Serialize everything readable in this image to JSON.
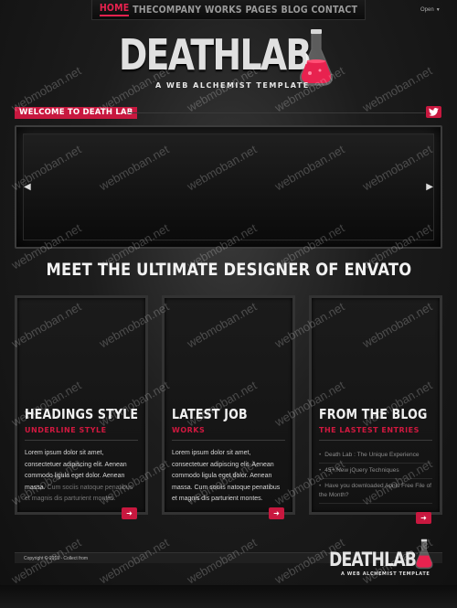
{
  "nav": {
    "items": [
      "HOME",
      "THECOMPANY",
      "WORKS",
      "PAGES",
      "BLOG",
      "CONTACT"
    ],
    "active_index": 0,
    "open_label": "Open"
  },
  "logo": {
    "name": "DEATHLAB",
    "tagline": "A WEB ALCHEMIST TEMPLATE",
    "flask_color": "#e8224f"
  },
  "welcome": {
    "label": "WELCOME TO DEATH LAB",
    "twitter_icon": "twitter-bird-icon"
  },
  "slider": {
    "prev_icon": "chevron-left-icon",
    "next_icon": "chevron-right-icon"
  },
  "headline": "MEET THE ULTIMATE DESIGNER OF ENVATO",
  "columns": [
    {
      "title": "HEADINGS STYLE",
      "subtitle": "UNDERLINE STYLE",
      "body_main": "Lorem ipsum dolor sit amet, consectetuer adipiscing elit. Aenean commodo ligula eget dolor. Aenean massa. ",
      "body_dim": "Cum sociis natoque penatibus et magnis dis parturient montes."
    },
    {
      "title": "LATEST JOB",
      "subtitle": "WORKS",
      "body_main": "Lorem ipsum dolor sit amet, consectetuer adipiscing elit. Aenean commodo ligula eget dolor. Aenean massa. Cum sociis natoque penatibus et magnis dis parturient montes.",
      "body_dim": ""
    },
    {
      "title": "FROM THE BLOG",
      "subtitle": "THE LASTEST ENTRIES",
      "entries": [
        "Death Lab : The Unique Experience",
        "45+ New jQuery Techniques",
        "Have you downloaded Apnis Free File of the Month?"
      ]
    }
  ],
  "more_icon": "chevron-right-icon",
  "footer": {
    "copyright": "Copyright © 2013 - Collect from",
    "logo_name": "DEATHLAB",
    "logo_tagline": "A WEB ALCHEMIST TEMPLATE"
  },
  "watermark": "webmoban.net",
  "colors": {
    "accent": "#c8183f",
    "background": "#141414"
  }
}
